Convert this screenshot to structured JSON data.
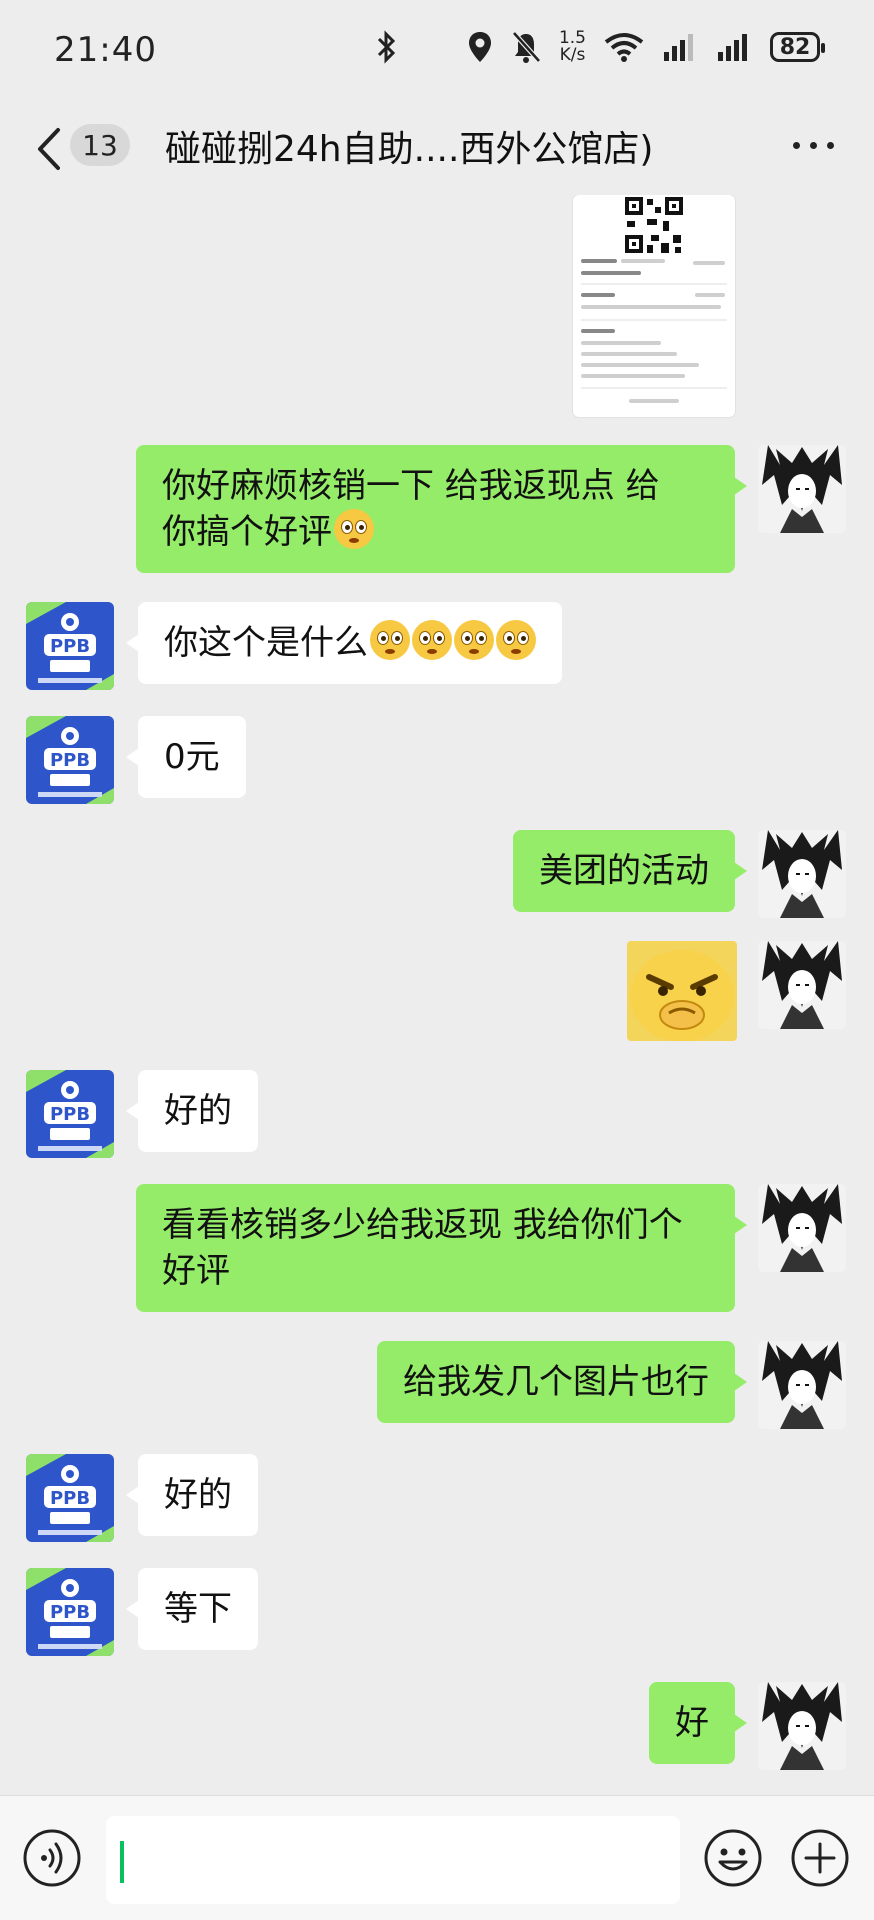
{
  "status_bar": {
    "time": "21:40",
    "net_speed_value": "1.5",
    "net_speed_unit": "K/s",
    "battery": "82",
    "icons": [
      "bluetooth-icon",
      "location-icon",
      "mute-bell-icon",
      "wifi-icon",
      "signal-icon",
      "signal-icon",
      "battery-icon"
    ]
  },
  "nav": {
    "unread_count": "13",
    "title": "碰碰捌24h自助....西外公馆店)"
  },
  "messages": [
    {
      "side": "right",
      "type": "image",
      "content": "ticket-qr-image"
    },
    {
      "side": "right",
      "type": "text",
      "lines": [
        "你好麻烦核销一下 给我返现点 给",
        "你搞个好评"
      ],
      "emoji_count": 1
    },
    {
      "side": "left",
      "type": "text",
      "text": "你这个是什么",
      "emoji_count": 4
    },
    {
      "side": "left",
      "type": "text",
      "text": "0元"
    },
    {
      "side": "right",
      "type": "text",
      "text": "美团的活动"
    },
    {
      "side": "right",
      "type": "sticker",
      "content": "angry-face-sticker"
    },
    {
      "side": "left",
      "type": "text",
      "text": "好的"
    },
    {
      "side": "right",
      "type": "text",
      "lines": [
        "看看核销多少给我返现 我给你们个",
        "好评"
      ]
    },
    {
      "side": "right",
      "type": "text",
      "text": "给我发几个图片也行"
    },
    {
      "side": "left",
      "type": "text",
      "text": "好的"
    },
    {
      "side": "left",
      "type": "text",
      "text": "等下"
    },
    {
      "side": "right",
      "type": "text",
      "text": "好"
    }
  ],
  "input_bar": {
    "text_value": "",
    "icons": [
      "voice-icon",
      "emoji-icon",
      "plus-icon"
    ]
  },
  "colors": {
    "background": "#ededed",
    "outgoing_bubble": "#95ec69",
    "incoming_bubble": "#ffffff",
    "avatar_brand_blue": "#2e55c9",
    "cursor": "#07c160"
  }
}
